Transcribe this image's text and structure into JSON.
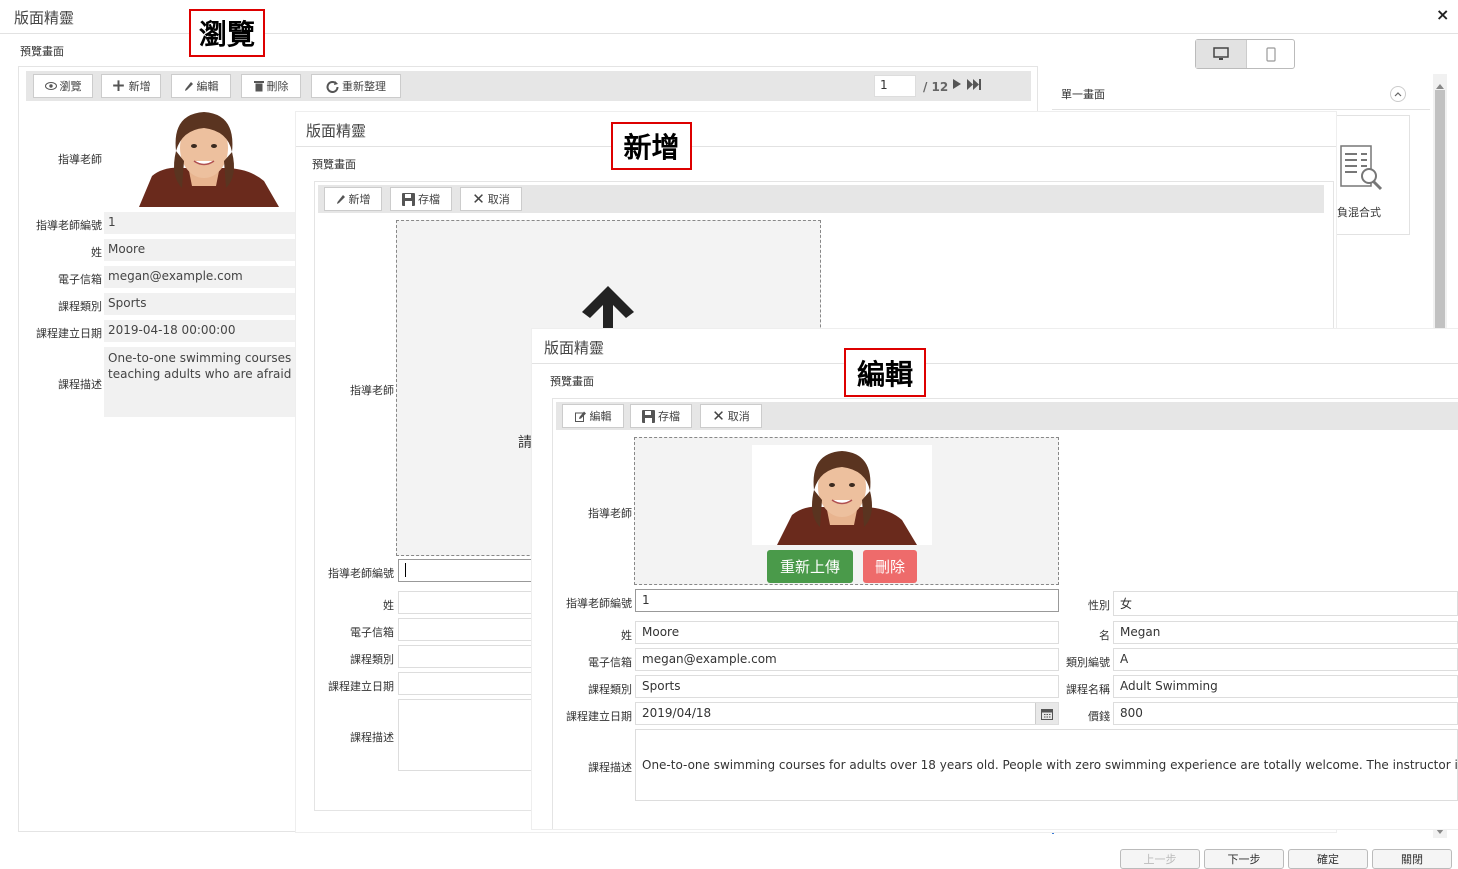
{
  "main": {
    "title": "版面精靈",
    "close_symbol": "×",
    "subtitle": "預覽畫面",
    "label_browse": "瀏覽",
    "label_add": "新增",
    "label_edit": "編輯"
  },
  "browse": {
    "toolbar": {
      "browse": "瀏覽",
      "add": "新增",
      "edit": "編輯",
      "delete": "刪除",
      "refresh": "重新整理"
    },
    "pager": {
      "current": "1",
      "total": "/ 12"
    },
    "fields": {
      "teacher": "指導老師",
      "teacher_id_label": "指導老師編號",
      "teacher_id": "1",
      "surname_label": "姓",
      "surname": "Moore",
      "email_label": "電子信箱",
      "email": "megan@example.com",
      "category_label": "課程類別",
      "category": "Sports",
      "created_label": "課程建立日期",
      "created": "2019-04-18 00:00:00",
      "desc_label": "課程描述",
      "desc_line1": "One-to-one swimming courses fo",
      "desc_line2": "teaching adults who are afraid of"
    }
  },
  "right_panel": {
    "title": "單一畫面",
    "card_label": "負混合式"
  },
  "add": {
    "title": "版面精靈",
    "subtitle": "預覽畫面",
    "toolbar": {
      "add": "新增",
      "save": "存檔",
      "cancel": "取消"
    },
    "upload_hint": "請",
    "fields": {
      "teacher": "指導老師",
      "teacher_id_label": "指導老師編號",
      "surname_label": "姓",
      "email_label": "電子信箱",
      "category_label": "課程類別",
      "created_label": "課程建立日期",
      "desc_label": "課程描述"
    }
  },
  "edit": {
    "title": "版面精靈",
    "subtitle": "預覽畫面",
    "toolbar": {
      "edit": "編輯",
      "save": "存檔",
      "cancel": "取消"
    },
    "reupload": "重新上傳",
    "delete": "刪除",
    "fields": {
      "teacher": "指導老師",
      "teacher_id_label": "指導老師編號",
      "teacher_id": "1",
      "gender_label": "性別",
      "gender": "女",
      "surname_label": "姓",
      "surname": "Moore",
      "given_label": "名",
      "given": "Megan",
      "email_label": "電子信箱",
      "email": "megan@example.com",
      "category_id_label": "類別編號",
      "category_id": "A",
      "category_label": "課程類別",
      "category": "Sports",
      "course_name_label": "課程名稱",
      "course_name": "Adult Swimming",
      "created_label": "課程建立日期",
      "created": "2019/04/18",
      "price_label": "價錢",
      "price": "800",
      "desc_label": "課程描述",
      "desc": "One-to-one swimming courses for adults over 18 years old. People with zero swimming experience are totally welcome. The instructor is especially"
    }
  },
  "footer": {
    "prev": "上一步",
    "next": "下一步",
    "ok": "確定",
    "close": "關閉"
  },
  "colors": {
    "green": "#4a9a4a",
    "red": "#ee6b6b",
    "label_red": "#dd0000"
  }
}
